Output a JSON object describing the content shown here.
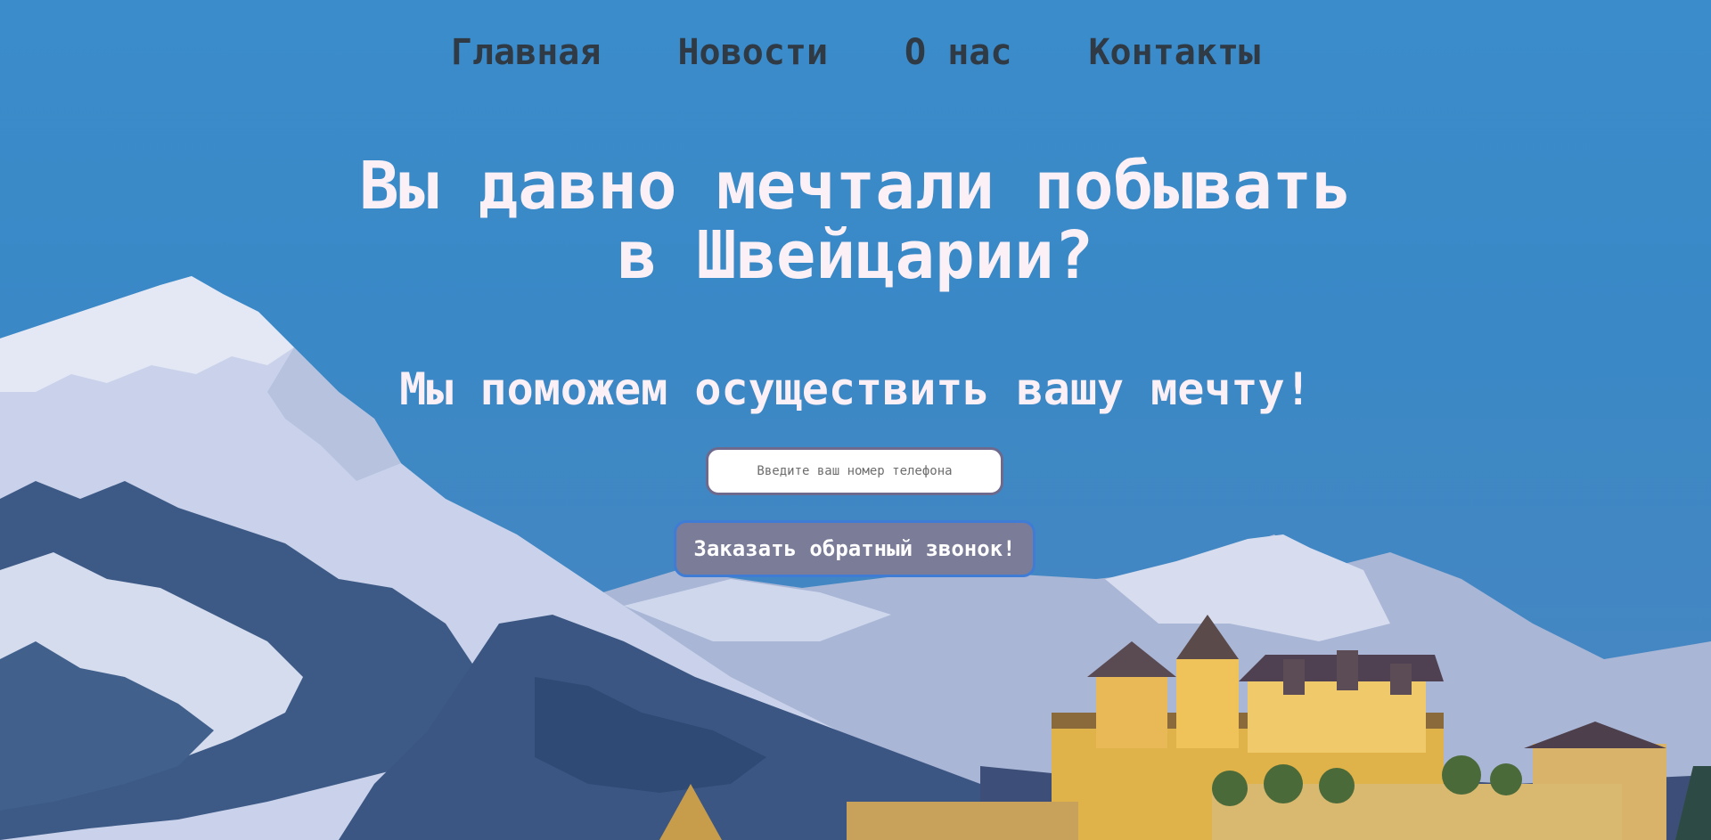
{
  "nav": {
    "items": [
      {
        "label": "Главная"
      },
      {
        "label": "Новости"
      },
      {
        "label": "О нас"
      },
      {
        "label": "Контакты"
      }
    ]
  },
  "hero": {
    "headline": "Вы давно мечтали побывать в Швейцарии?",
    "subheadline": "Мы поможем осуществить вашу мечту!",
    "phone_placeholder": "Введите ваш номер телефона",
    "phone_value": "",
    "callback_label": "Заказать обратный звонок!"
  },
  "colors": {
    "sky": "#3b8ccb",
    "nav_text": "#2f3a45",
    "hero_text": "#fbf0f6",
    "button_bg": "#7a7c98",
    "button_border": "#3e7cd6"
  },
  "background": {
    "icons": [
      "mountain-range",
      "forest",
      "castle"
    ]
  }
}
